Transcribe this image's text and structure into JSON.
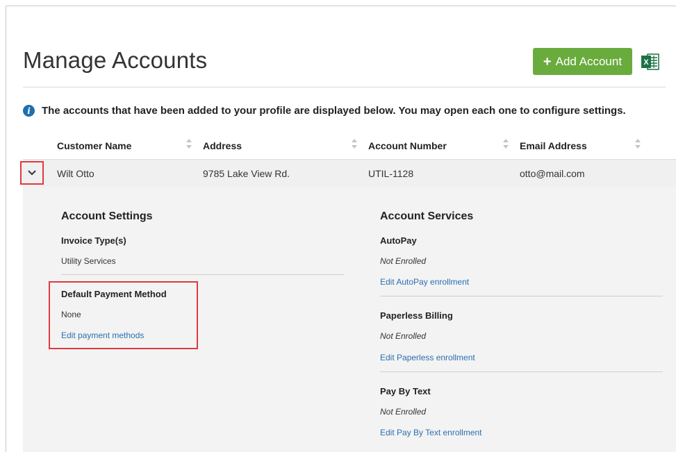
{
  "header": {
    "title": "Manage Accounts",
    "add_button_label": "Add Account",
    "export_icon": "excel-icon"
  },
  "info": {
    "icon": "info-icon",
    "text": "The accounts that have been added to your profile are displayed below. You may open each one to configure settings."
  },
  "table": {
    "columns": [
      "Customer Name",
      "Address",
      "Account Number",
      "Email Address"
    ],
    "rows": [
      {
        "customer_name": "Wilt Otto",
        "address": "9785 Lake View Rd.",
        "account_number": "UTIL-1128",
        "email": "otto@mail.com",
        "expanded": true
      }
    ]
  },
  "account_settings": {
    "heading": "Account Settings",
    "invoice_types_label": "Invoice Type(s)",
    "invoice_types_value": "Utility Services",
    "default_payment_label": "Default Payment Method",
    "default_payment_value": "None",
    "edit_payment_link": "Edit payment methods"
  },
  "account_services": {
    "heading": "Account Services",
    "autopay_label": "AutoPay",
    "autopay_value": "Not Enrolled",
    "autopay_link": "Edit AutoPay enrollment",
    "paperless_label": "Paperless Billing",
    "paperless_value": "Not Enrolled",
    "paperless_link": "Edit Paperless enrollment",
    "text_label": "Pay By Text",
    "text_value": "Not Enrolled",
    "text_link": "Edit Pay By Text enrollment"
  },
  "colors": {
    "accent_green": "#6aab3e",
    "link_blue": "#2a6fb0",
    "highlight_red": "#e0393e",
    "info_blue": "#1f6fb0"
  }
}
